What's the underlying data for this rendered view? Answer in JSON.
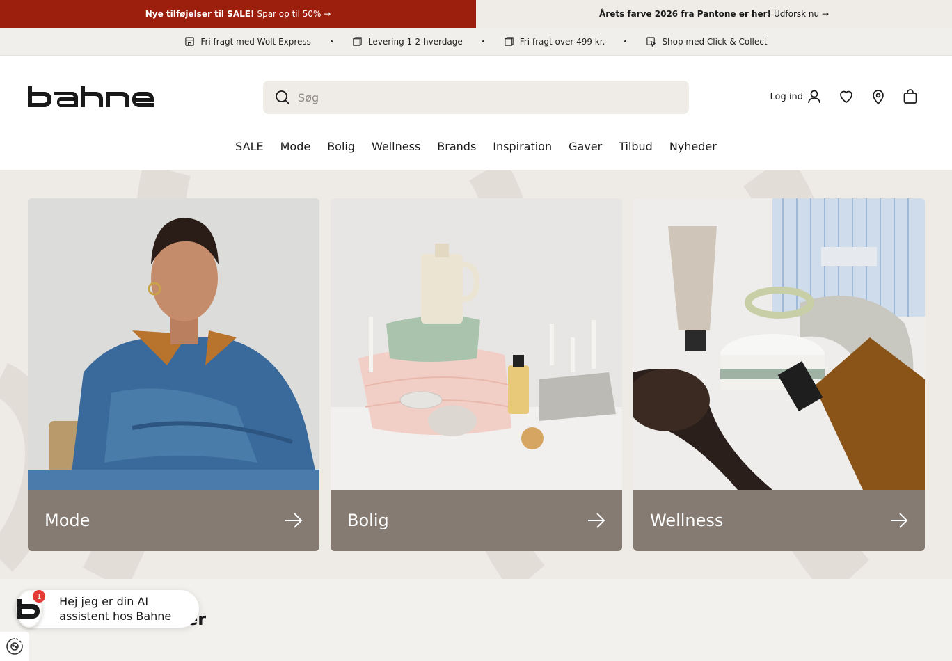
{
  "promo": {
    "left_bold": "Nye tilføjelser til SALE!",
    "left_text": "Spar op til 50% →",
    "right_bold": "Årets farve 2026 fra Pantone er her!",
    "right_text": "Udforsk nu →"
  },
  "usp": [
    {
      "label": "Fri fragt med Wolt Express",
      "icon": "store-icon"
    },
    {
      "label": "Levering 1-2 hverdage",
      "icon": "box-icon"
    },
    {
      "label": "Fri fragt over 499 kr.",
      "icon": "box-icon"
    },
    {
      "label": "Shop med Click & Collect",
      "icon": "click-collect-icon"
    }
  ],
  "header": {
    "logo": "bahne",
    "search_placeholder": "Søg",
    "login_label": "Log ind"
  },
  "nav": [
    "SALE",
    "Mode",
    "Bolig",
    "Wellness",
    "Brands",
    "Inspiration",
    "Gaver",
    "Tilbud",
    "Nyheder"
  ],
  "cards": [
    {
      "label": "Mode"
    },
    {
      "label": "Bolig"
    },
    {
      "label": "Wellness"
    }
  ],
  "lower": {
    "heading_partial": "er"
  },
  "chat": {
    "badge": "1",
    "message": "Hej   jeg er din AI assistent hos Bahne"
  },
  "colors": {
    "promo_red": "#9c1f0d",
    "card_bar": "#857b72",
    "search_bg": "#efece8"
  }
}
